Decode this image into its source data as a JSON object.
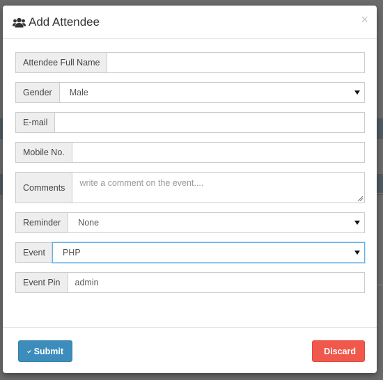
{
  "modal": {
    "title": "Add Attendee",
    "title_icon": "users-icon",
    "close_label": "×"
  },
  "form": {
    "full_name": {
      "label": "Attendee Full Name",
      "value": ""
    },
    "gender": {
      "label": "Gender",
      "selected": "Male"
    },
    "email": {
      "label": "E-mail",
      "value": ""
    },
    "mobile": {
      "label": "Mobile No.",
      "value": ""
    },
    "comments": {
      "label": "Comments",
      "placeholder": "write a comment on the event...."
    },
    "reminder": {
      "label": "Reminder",
      "selected": "None"
    },
    "event": {
      "label": "Event",
      "selected": "PHP"
    },
    "event_pin": {
      "label": "Event Pin",
      "value": "admin"
    }
  },
  "footer": {
    "submit_label": "Submit",
    "submit_icon": "check-icon",
    "discard_label": "Discard",
    "discard_icon": "times-icon"
  },
  "colors": {
    "submit": "#3c8dbc",
    "discard": "#f0584c",
    "focus_border": "#66afe9"
  }
}
